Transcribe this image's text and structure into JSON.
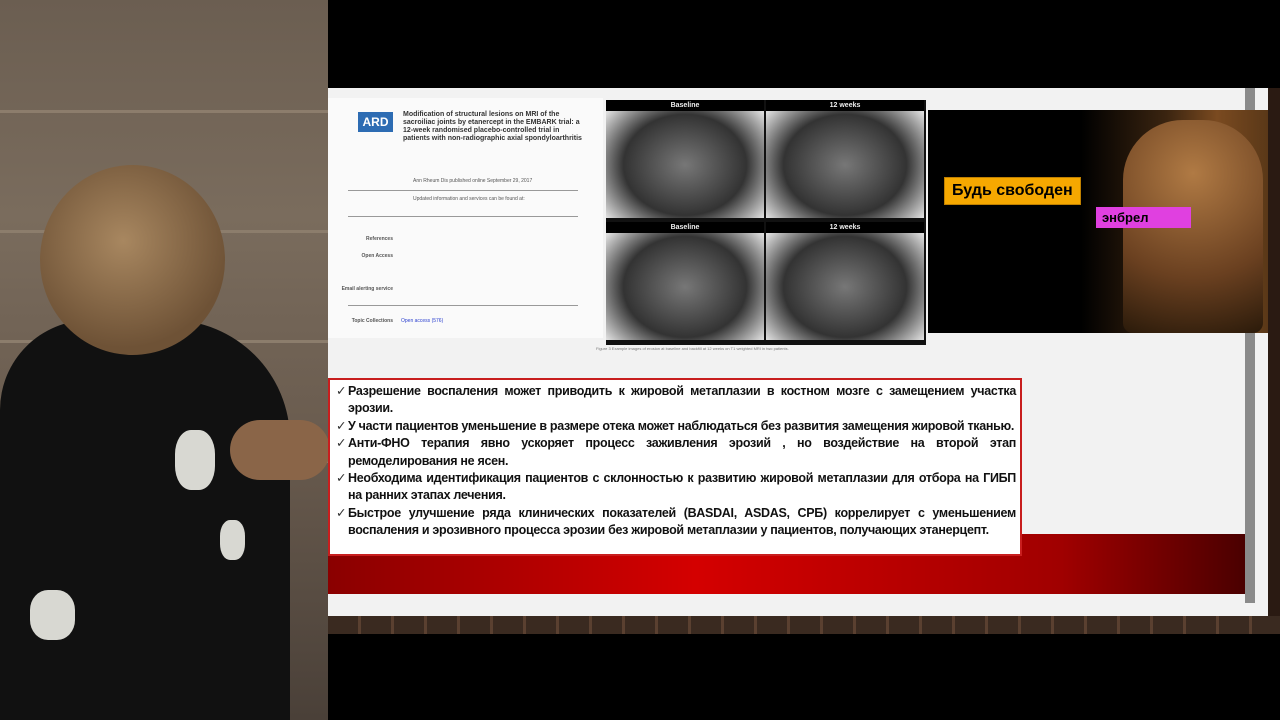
{
  "article": {
    "journal_logo": "ARD",
    "title": "Modification of structural lesions on MRI of the sacroiliac joints by etanercept in the EMBARK trial: a 12-week randomised placebo-controlled trial in patients with non-radiographic axial spondyloarthritis",
    "published": "Ann Rheum Dis published online September 29, 2017",
    "updated_info": "Updated information and services can be found at:",
    "references_label": "References",
    "open_access_label": "Open Access",
    "email_label": "Email alerting service",
    "topic_label": "Topic Collections",
    "topic_link": "Open access (576)"
  },
  "mri": {
    "baseline": "Baseline",
    "weeks12": "12 weeks",
    "caption": "Figure 3  Example images of erosion at baseline and backfill at 12 weeks on T1 weighted MRI in two patients."
  },
  "movie": {
    "tag1": "Будь свободен",
    "tag2": "энбрел"
  },
  "bullets": [
    "Разрешение воспаления может приводить к жировой метаплазии в костном мозге с замещением участка эрозии.",
    "У части пациентов уменьшение в размере отека может наблюдаться без развития замещения жировой тканью.",
    "Анти-ФНО терапия явно ускоряет процесс заживления эрозий , но воздействие на второй этап ремоделирования не ясен.",
    "Необходима идентификация пациентов с склонностью к развитию жировой метаплазии для отбора на ГИБП на ранних этапах лечения.",
    "Быстрое улучшение ряда клинических показателей (BASDAI, ASDAS, СРБ) коррелирует с уменьшением воспаления и эрозивного процесса эрозии без жировой метаплазии у пациентов, получающих этанерцепт."
  ],
  "check_icon": "✓"
}
